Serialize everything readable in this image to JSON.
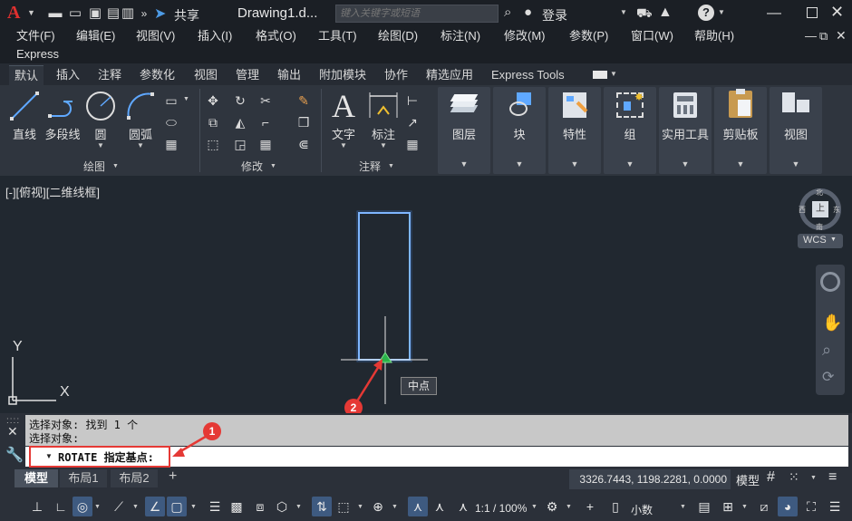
{
  "titlebar": {
    "app_icon": "A",
    "share_label": "共享",
    "doc_title": "Drawing1.d...",
    "search_placeholder": "键入关键字或短语",
    "login_label": "登录"
  },
  "menubar": {
    "items": [
      "文件(F)",
      "编辑(E)",
      "视图(V)",
      "插入(I)",
      "格式(O)",
      "工具(T)",
      "绘图(D)",
      "标注(N)",
      "修改(M)",
      "参数(P)",
      "窗口(W)",
      "帮助(H)"
    ],
    "second_row": "Express"
  },
  "ribbon_tabs": [
    "默认",
    "插入",
    "注释",
    "参数化",
    "视图",
    "管理",
    "输出",
    "附加模块",
    "协作",
    "精选应用",
    "Express Tools"
  ],
  "ribbon": {
    "draw": {
      "line": "直线",
      "polyline": "多段线",
      "circle": "圆",
      "arc": "圆弧",
      "title": "绘图"
    },
    "modify": {
      "title": "修改"
    },
    "annotation": {
      "text": "文字",
      "dimension": "标注",
      "title": "注释"
    },
    "groups": [
      "图层",
      "块",
      "特性",
      "组",
      "实用工具",
      "剪贴板",
      "视图"
    ]
  },
  "canvas": {
    "viewport_label": "[-][俯视][二维线框]",
    "wcs_label": "WCS",
    "snap_tooltip": "中点",
    "ucs_y": "Y",
    "ucs_x": "X",
    "marker_1": "1",
    "marker_2": "2",
    "viewcube_n": "北",
    "viewcube_s": "南",
    "viewcube_w": "西",
    "viewcube_e": "东",
    "viewcube_top": "上"
  },
  "command": {
    "history_1": "选择对象: 找到 1 个",
    "history_2": "选择对象:",
    "prompt": "ROTATE 指定基点:"
  },
  "layout_tabs": [
    "模型",
    "布局1",
    "布局2"
  ],
  "status": {
    "coords": "3326.7443, 1198.2281, 0.0000",
    "model_label": "模型",
    "scale": "1:1 / 100%",
    "units": "小数"
  }
}
